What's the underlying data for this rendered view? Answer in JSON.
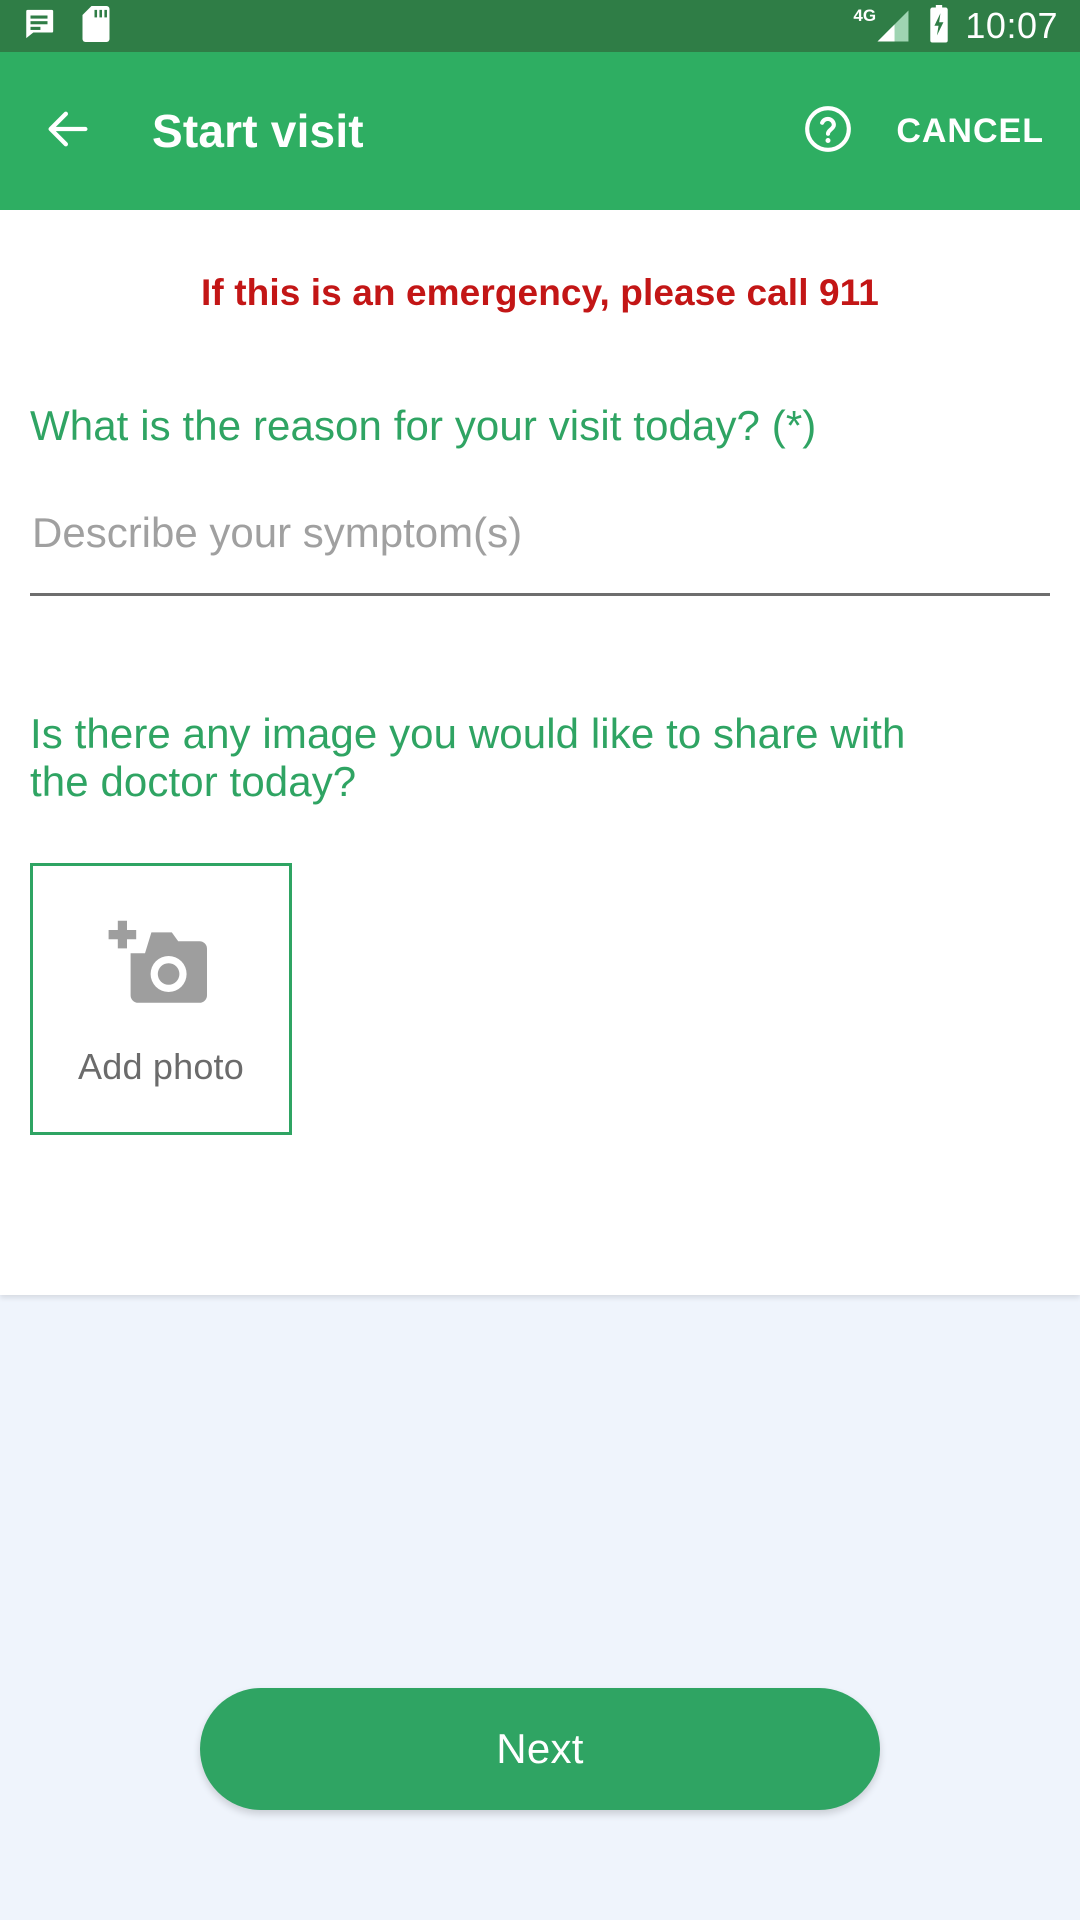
{
  "status_bar": {
    "icons": [
      "message-icon",
      "sd-card-icon"
    ],
    "network_type": "4G",
    "battery_state": "charging",
    "time": "10:07",
    "background_color": "#2f7d46"
  },
  "app_bar": {
    "back_icon": "arrow-left-icon",
    "title": "Start visit",
    "help_icon": "help-circle-icon",
    "cancel_label": "CANCEL",
    "background_color": "#2eae62"
  },
  "content": {
    "emergency_note": "If this is an emergency, please call 911",
    "emergency_color": "#c31616",
    "accent_color": "#2fa463",
    "question_1": "What is the reason for your visit today? (*)",
    "symptom_field": {
      "value": "",
      "placeholder": "Describe your symptom(s)"
    },
    "question_2": "Is there any image you would like to share with the doctor today?",
    "add_photo": {
      "icon": "add-a-photo-icon",
      "label": "Add photo"
    }
  },
  "footer": {
    "next_label": "Next",
    "next_color": "#2fa463",
    "background_color": "#eff4fc"
  }
}
